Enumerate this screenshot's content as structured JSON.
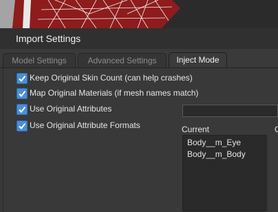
{
  "header": {
    "title": "Import Settings"
  },
  "tabs": [
    {
      "label": "Model Settings",
      "active": false
    },
    {
      "label": "Advanced Settings",
      "active": false
    },
    {
      "label": "Inject Mode",
      "active": true
    }
  ],
  "options": [
    {
      "label": "Keep Original Skin Count (can help crashes)",
      "checked": true
    },
    {
      "label": "Map Original Materials (if mesh names match)",
      "checked": true
    },
    {
      "label": "Use Original Attributes",
      "checked": true
    },
    {
      "label": "Use Original Attribute Formats",
      "checked": true
    }
  ],
  "current": {
    "label": "Current",
    "items": [
      "Body__m_Eye",
      "Body__m_Body"
    ]
  },
  "right_column": {
    "label": "C"
  },
  "colors": {
    "accent": "#4a8fd6",
    "mesh": "#8b1a1a"
  }
}
